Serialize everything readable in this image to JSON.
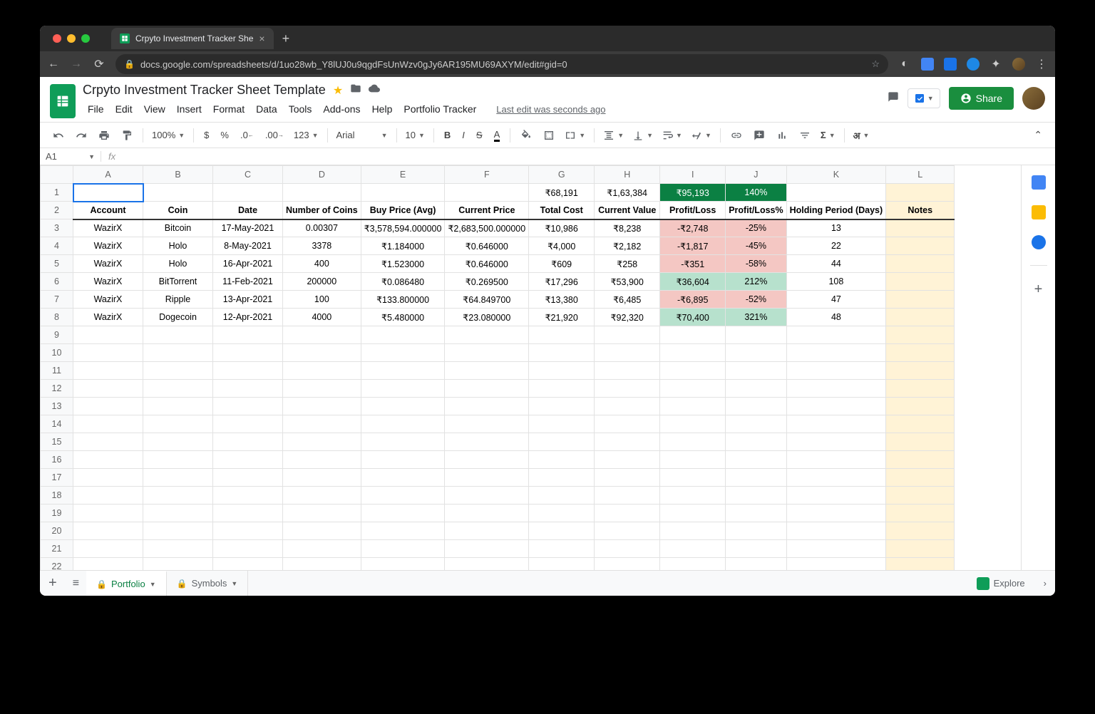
{
  "browser": {
    "tab_title": "Crpyto Investment Tracker She",
    "url": "docs.google.com/spreadsheets/d/1uo28wb_Y8lUJ0u9qgdFsUnWzv0gJy6AR195MU69AXYM/edit#gid=0"
  },
  "doc": {
    "title": "Crpyto Investment Tracker Sheet Template",
    "last_edit": "Last edit was seconds ago",
    "share": "Share"
  },
  "menus": [
    "File",
    "Edit",
    "View",
    "Insert",
    "Format",
    "Data",
    "Tools",
    "Add-ons",
    "Help",
    "Portfolio Tracker"
  ],
  "toolbar": {
    "zoom": "100%",
    "currency": "$",
    "percent": "%",
    "dec_dec": ".0",
    "inc_dec": ".00",
    "numfmt": "123",
    "font": "Arial",
    "fontsize": "10",
    "script": "अ"
  },
  "namebox": "A1",
  "columns": [
    "A",
    "B",
    "C",
    "D",
    "E",
    "F",
    "G",
    "H",
    "I",
    "J",
    "K",
    "L"
  ],
  "totals": {
    "G": "₹68,191",
    "H": "₹1,63,384",
    "I": "₹95,193",
    "J": "140%"
  },
  "headers": [
    "Account",
    "Coin",
    "Date",
    "Number of Coins",
    "Buy Price (Avg)",
    "Current Price",
    "Total Cost",
    "Current Value",
    "Profit/Loss",
    "Profit/Loss%",
    "Holding Period (Days)",
    "Notes"
  ],
  "rows": [
    {
      "account": "WazirX",
      "coin": "Bitcoin",
      "date": "17-May-2021",
      "num": "0.00307",
      "buy": "₹3,578,594.000000",
      "cur": "₹2,683,500.000000",
      "cost": "₹10,986",
      "val": "₹8,238",
      "pl": "-₹2,748",
      "plp": "-25%",
      "hold": "13",
      "plclass": "lossred"
    },
    {
      "account": "WazirX",
      "coin": "Holo",
      "date": "8-May-2021",
      "num": "3378",
      "buy": "₹1.184000",
      "cur": "₹0.646000",
      "cost": "₹4,000",
      "val": "₹2,182",
      "pl": "-₹1,817",
      "plp": "-45%",
      "hold": "22",
      "plclass": "lossred"
    },
    {
      "account": "WazirX",
      "coin": "Holo",
      "date": "16-Apr-2021",
      "num": "400",
      "buy": "₹1.523000",
      "cur": "₹0.646000",
      "cost": "₹609",
      "val": "₹258",
      "pl": "-₹351",
      "plp": "-58%",
      "hold": "44",
      "plclass": "lossred"
    },
    {
      "account": "WazirX",
      "coin": "BitTorrent",
      "date": "11-Feb-2021",
      "num": "200000",
      "buy": "₹0.086480",
      "cur": "₹0.269500",
      "cost": "₹17,296",
      "val": "₹53,900",
      "pl": "₹36,604",
      "plp": "212%",
      "hold": "108",
      "plclass": "gaingreen"
    },
    {
      "account": "WazirX",
      "coin": "Ripple",
      "date": "13-Apr-2021",
      "num": "100",
      "buy": "₹133.800000",
      "cur": "₹64.849700",
      "cost": "₹13,380",
      "val": "₹6,485",
      "pl": "-₹6,895",
      "plp": "-52%",
      "hold": "47",
      "plclass": "lossred"
    },
    {
      "account": "WazirX",
      "coin": "Dogecoin",
      "date": "12-Apr-2021",
      "num": "4000",
      "buy": "₹5.480000",
      "cur": "₹23.080000",
      "cost": "₹21,920",
      "val": "₹92,320",
      "pl": "₹70,400",
      "plp": "321%",
      "hold": "48",
      "plclass": "gaingreen"
    }
  ],
  "sheets": {
    "active": "Portfolio",
    "other": "Symbols"
  },
  "explore": "Explore",
  "colwidths": {
    "A": 98,
    "B": 98,
    "C": 98,
    "D": 98,
    "E": 108,
    "F": 108,
    "G": 92,
    "H": 92,
    "I": 92,
    "J": 82,
    "K": 122,
    "L": 96
  }
}
